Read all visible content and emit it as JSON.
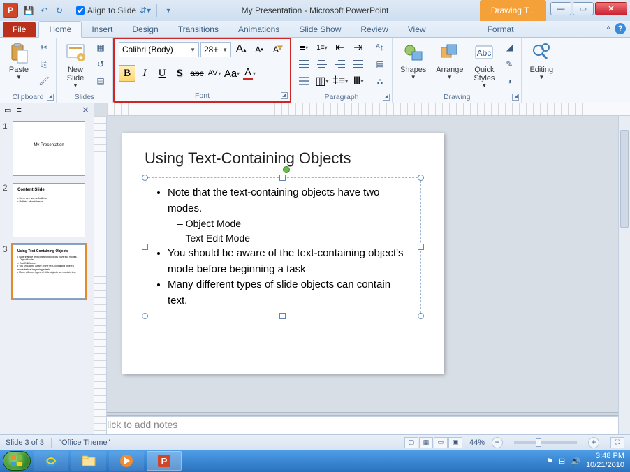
{
  "titlebar": {
    "app_icon": "P",
    "qat_align_label": "Align to Slide",
    "title": "My Presentation  -  Microsoft PowerPoint",
    "context_tab": "Drawing T..."
  },
  "tabs": {
    "file": "File",
    "items": [
      "Home",
      "Insert",
      "Design",
      "Transitions",
      "Animations",
      "Slide Show",
      "Review",
      "View"
    ],
    "format": "Format",
    "active_index": 0
  },
  "ribbon": {
    "clipboard": {
      "paste": "Paste",
      "label": "Clipboard"
    },
    "slides": {
      "new_slide": "New\nSlide",
      "label": "Slides"
    },
    "font": {
      "label": "Font",
      "font_name": "Calibri (Body)",
      "font_size": "28+",
      "bold": "B",
      "italic": "I",
      "underline": "U",
      "shadow": "S",
      "strike": "abc",
      "spacing": "AV",
      "case": "Aa",
      "clear": "A",
      "grow": "A",
      "shrink": "A",
      "cleartop": "Aª"
    },
    "paragraph": {
      "label": "Paragraph"
    },
    "drawing": {
      "label": "Drawing",
      "shapes": "Shapes",
      "arrange": "Arrange",
      "quick": "Quick\nStyles"
    },
    "editing": {
      "label": "Editing",
      "btn": "Editing"
    }
  },
  "thumbnails": {
    "tab_slides_icon": "▭",
    "tab_outline_icon": "≡",
    "items": [
      {
        "num": "1",
        "title": "My Presentation",
        "body": ""
      },
      {
        "num": "2",
        "title": "Content Slide",
        "body": "• Here are some bullets\n• Bullets about ideas"
      },
      {
        "num": "3",
        "title": "Using Text-Containing Objects",
        "body": "• Note that the text-containing objects have two modes.\n   – Object Mode\n   – Text Edit Mode\n• You should be aware of the text-containing object's mode before beginning a task\n• Many different types of slide objects can contain text."
      }
    ],
    "selected_index": 2
  },
  "slide": {
    "title": "Using Text-Containing Objects",
    "bullets": [
      "Note that the text-containing objects have two modes.",
      "You should be aware of the text-containing object's mode before beginning a task",
      "Many different types of slide objects can contain text."
    ],
    "sub_bullets": [
      "Object Mode",
      "Text Edit Mode"
    ]
  },
  "notes": {
    "placeholder": "Click to add notes"
  },
  "statusbar": {
    "slide_info": "Slide 3 of 3",
    "theme": "\"Office Theme\"",
    "zoom": "44%"
  },
  "taskbar": {
    "time": "3:48 PM",
    "date": "10/21/2010"
  }
}
